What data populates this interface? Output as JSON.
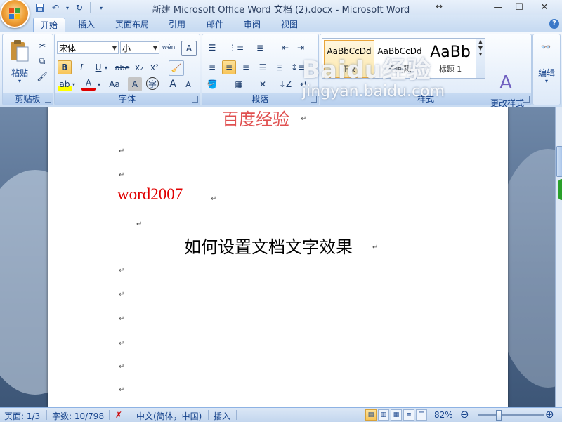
{
  "window": {
    "title": "新建 Microsoft Office Word 文档 (2).docx - Microsoft Word",
    "controls": [
      "minimize",
      "maximize",
      "close"
    ]
  },
  "quick_access": {
    "icons": [
      "save-icon",
      "undo-icon",
      "redo-icon",
      "customize-icon"
    ]
  },
  "tabs": [
    {
      "label": "开始",
      "active": true
    },
    {
      "label": "插入"
    },
    {
      "label": "页面布局"
    },
    {
      "label": "引用"
    },
    {
      "label": "邮件"
    },
    {
      "label": "审阅"
    },
    {
      "label": "视图"
    }
  ],
  "ribbon": {
    "clipboard": {
      "label": "剪贴板",
      "paste_label": "粘贴"
    },
    "font": {
      "label": "字体",
      "font_name": "宋体",
      "font_size": "小一",
      "buttons": [
        "B",
        "I",
        "U",
        "abe",
        "x₂",
        "x²",
        "Aa",
        "A",
        "A",
        "A"
      ]
    },
    "paragraph": {
      "label": "段落"
    },
    "styles": {
      "label": "样式",
      "tiles": [
        {
          "sample": "AaBbCcDd",
          "name": "正文",
          "selected": true
        },
        {
          "sample": "AaBbCcDd",
          "name": "无间隔"
        },
        {
          "sample": "AaBb",
          "name": "标题 1"
        }
      ],
      "change_styles_label": "更改样式"
    },
    "editing": {
      "label": "编辑"
    }
  },
  "document": {
    "header_text": "百度经验",
    "line1": "word2007",
    "line2": "如何设置文档文字效果",
    "paragraph_mark": "↵"
  },
  "watermark": {
    "logo": "Baidu经验",
    "url": "jingyan.baidu.com"
  },
  "status": {
    "page": "页面: 1/3",
    "words": "字数: 10/798",
    "language": "中文(简体，中国)",
    "mode": "插入",
    "zoom": "82%",
    "zoom_value": 0.82
  },
  "colors": {
    "accent": "#15428b",
    "red_text": "#e00000",
    "header_text": "#e05050"
  }
}
